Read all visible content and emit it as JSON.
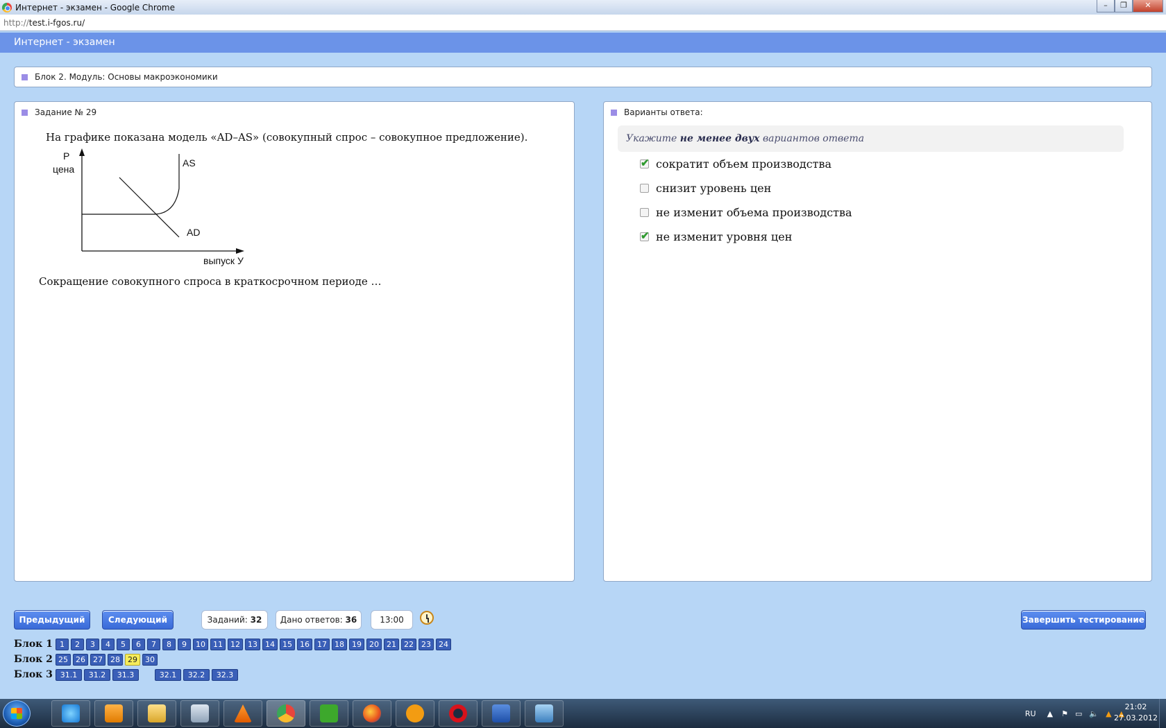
{
  "window": {
    "title": "Интернет - экзамен - Google Chrome",
    "url_scheme": "http://",
    "url_host": "test.i-fgos.ru/"
  },
  "site": {
    "header": "Интернет - экзамен",
    "block_title": "Блок 2. Модуль: Основы макроэкономики"
  },
  "question": {
    "label": "Задание № 29",
    "text": "На графике показана модель «AD–AS» (совокупный спрос – совокупное предложение).",
    "graph": {
      "y_label_1": "P",
      "y_label_2": "цена",
      "x_label": "выпуск У",
      "curve_as": "AS",
      "curve_ad": "AD"
    },
    "text2": "Сокращение совокупного спроса в краткосрочном периоде …"
  },
  "answers": {
    "label": "Варианты ответа:",
    "hint_pre": "Укажите ",
    "hint_bold": "не менее двух",
    "hint_post": " вариантов ответа",
    "options": [
      {
        "text": "сократит объем производства",
        "checked": true
      },
      {
        "text": "снизит уровень цен",
        "checked": false
      },
      {
        "text": "не изменит объема производства",
        "checked": false
      },
      {
        "text": "не изменит уровня цен",
        "checked": true
      }
    ]
  },
  "controls": {
    "prev": "Предыдущий",
    "next": "Следующий",
    "tasks_label": "Заданий:",
    "tasks_value": "32",
    "answered_label": "Дано ответов:",
    "answered_value": "36",
    "timer": "13:00",
    "finish": "Завершить тестирование"
  },
  "blocks": {
    "block1": {
      "label": "Блок 1",
      "items": [
        "1",
        "2",
        "3",
        "4",
        "5",
        "6",
        "7",
        "8",
        "9",
        "10",
        "11",
        "12",
        "13",
        "14",
        "15",
        "16",
        "17",
        "18",
        "19",
        "20",
        "21",
        "22",
        "23",
        "24"
      ]
    },
    "block2": {
      "label": "Блок 2",
      "items": [
        "25",
        "26",
        "27",
        "28",
        "29",
        "30"
      ],
      "current": "29"
    },
    "block3": {
      "label": "Блок 3",
      "items_a": [
        "31.1",
        "31.2",
        "31.3"
      ],
      "items_b": [
        "32.1",
        "32.2",
        "32.3"
      ]
    }
  },
  "taskbar": {
    "lang": "RU",
    "time": "21:02",
    "date": "27.03.2012"
  }
}
